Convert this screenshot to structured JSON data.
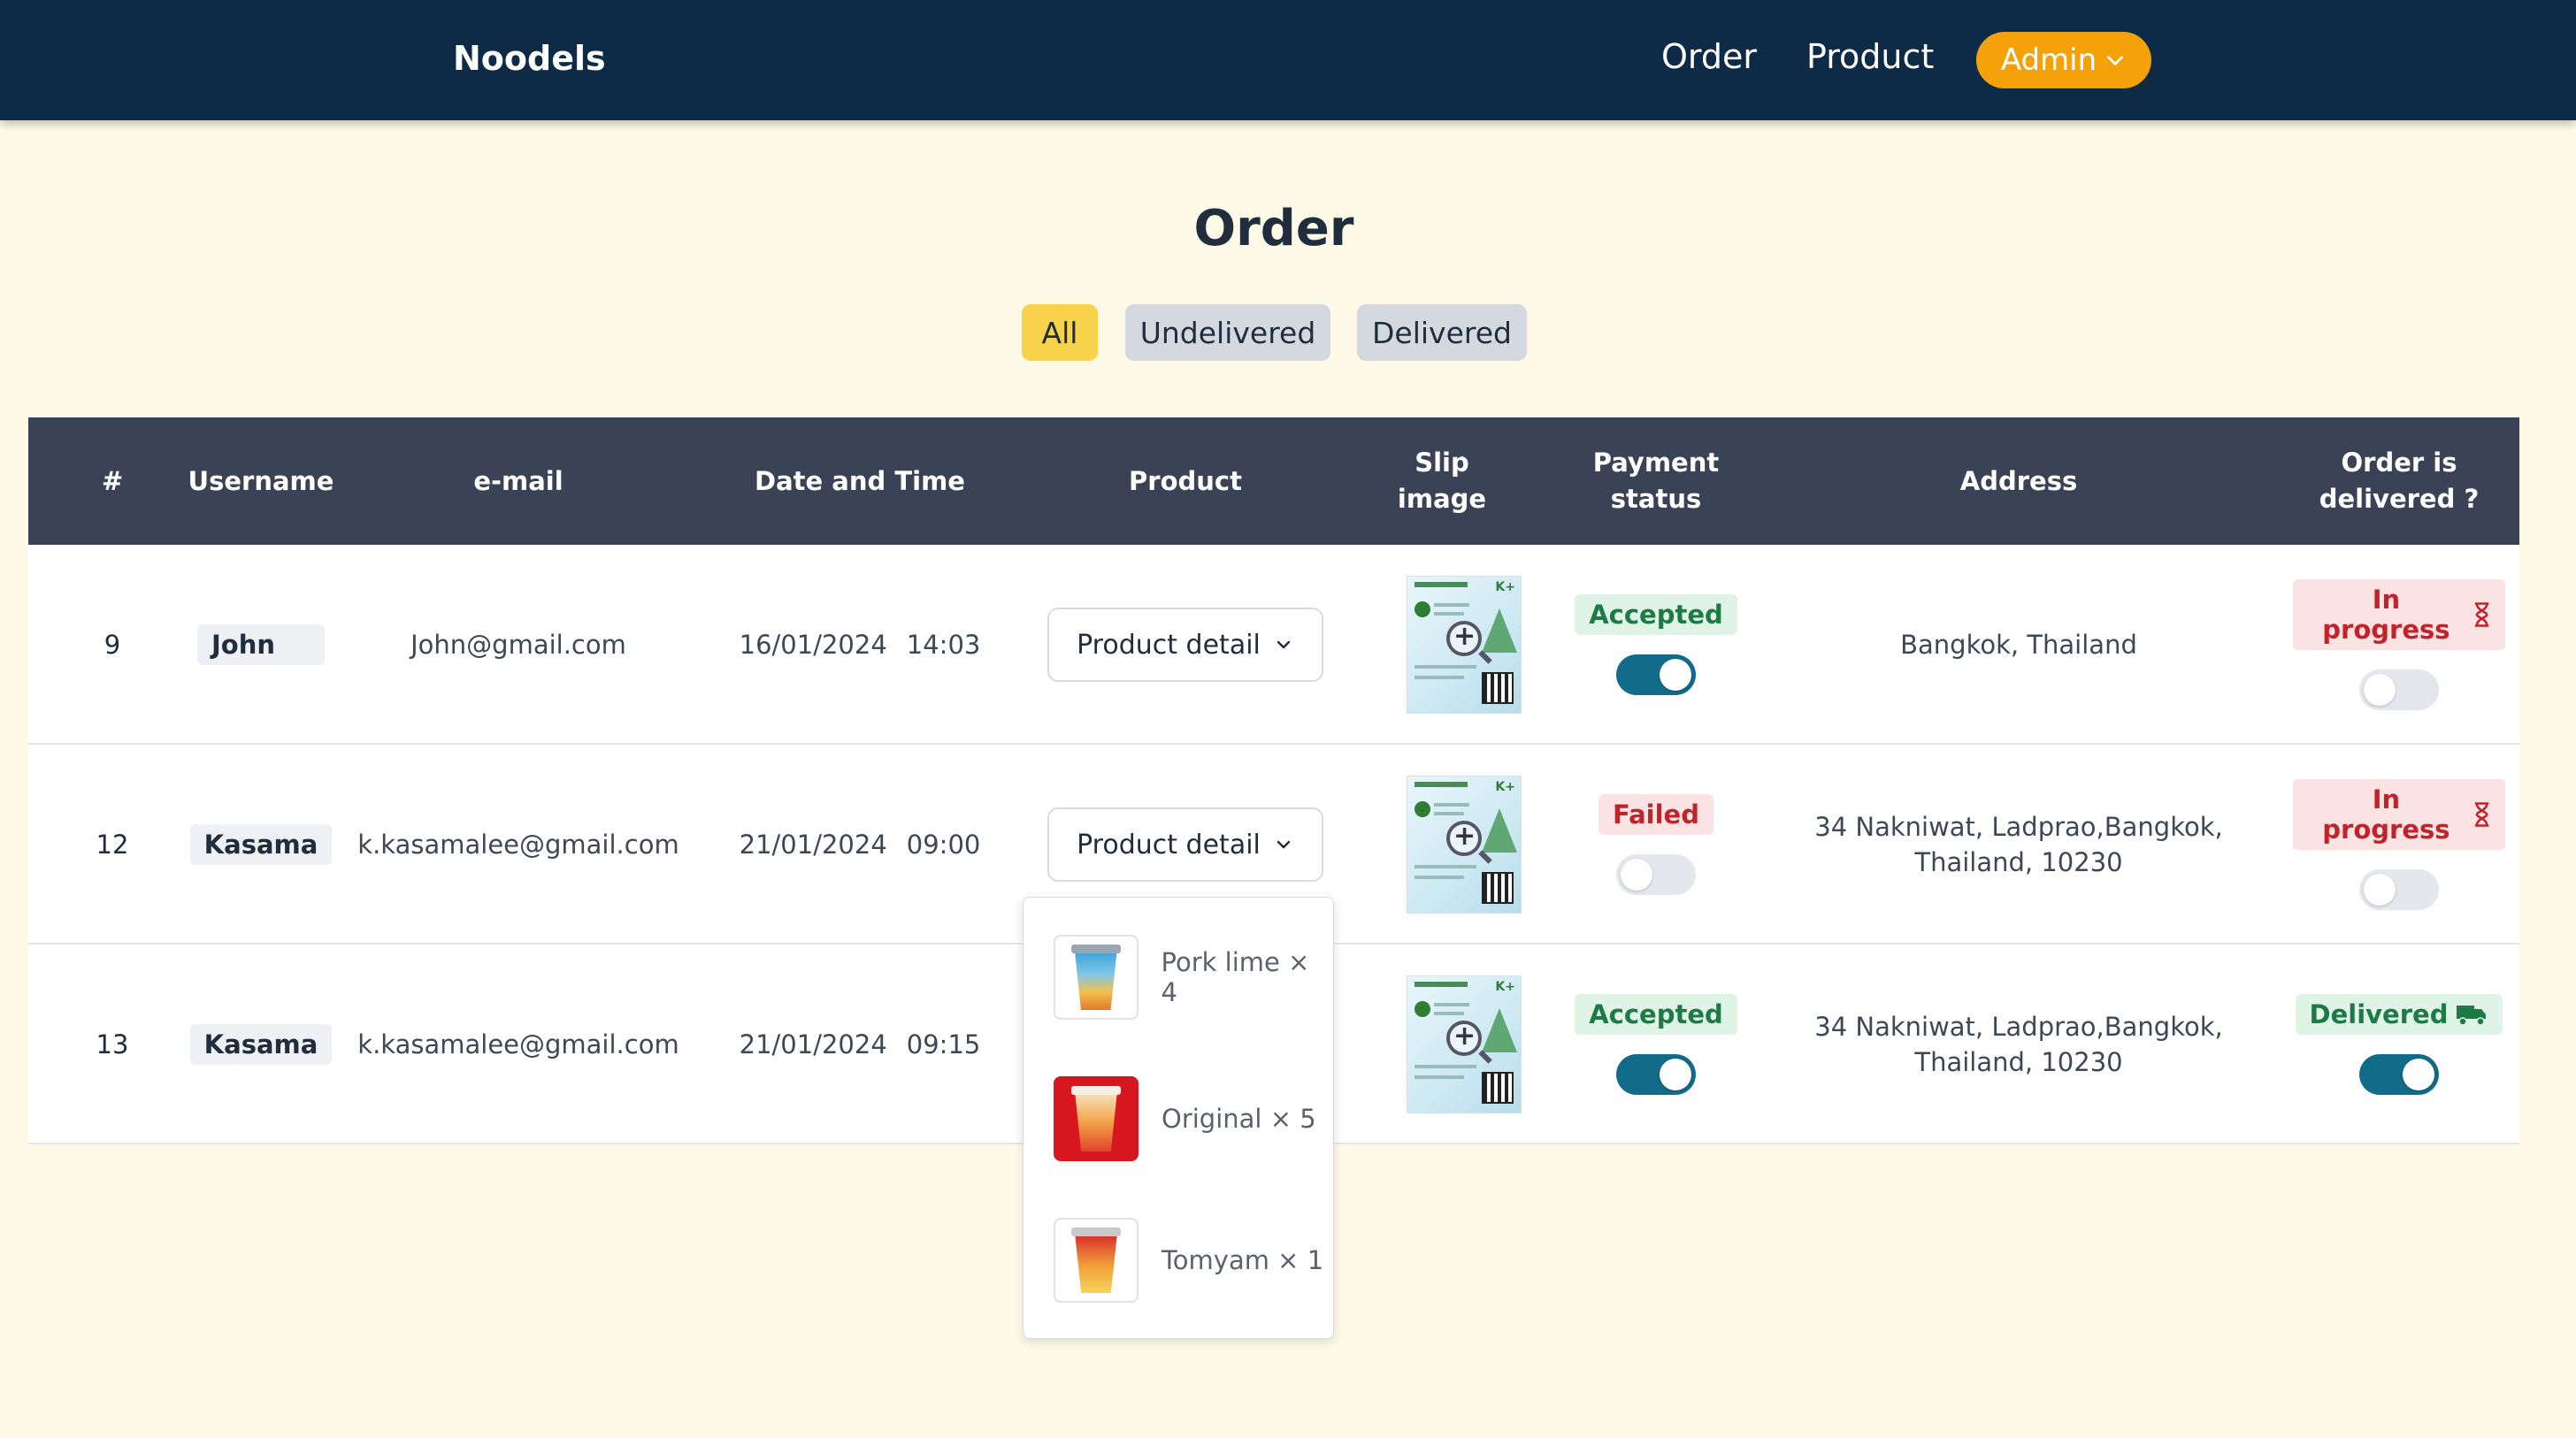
{
  "nav": {
    "brand": "Noodels",
    "links": [
      "Order",
      "Product"
    ],
    "admin_label": "Admin"
  },
  "page": {
    "title": "Order",
    "filters": [
      "All",
      "Undelivered",
      "Delivered"
    ],
    "active_filter": "All"
  },
  "table": {
    "headers": {
      "num": "#",
      "username": "Username",
      "email": "e-mail",
      "datetime": "Date and Time",
      "product": "Product",
      "slip_1": "Slip",
      "slip_2": "image",
      "payment_1": "Payment",
      "payment_2": "status",
      "address": "Address",
      "delivered_1": "Order is",
      "delivered_2": "delivered ?"
    },
    "rows": [
      {
        "num": "9",
        "username": "John",
        "email": "John@gmail.com",
        "date": "16/01/2024",
        "time": "14:03",
        "product_btn": "Product detail",
        "payment_status": "Accepted",
        "payment_on": true,
        "address_1": "Bangkok, Thailand",
        "address_2": "",
        "delivery_status": "In progress",
        "delivery_icon": "hourglass-icon",
        "delivered_on": false
      },
      {
        "num": "12",
        "username": "Kasama",
        "email": "k.kasamalee@gmail.com",
        "date": "21/01/2024",
        "time": "09:00",
        "product_btn": "Product detail",
        "payment_status": "Failed",
        "payment_on": false,
        "address_1": "34 Nakniwat, Ladprao,Bangkok,",
        "address_2": "Thailand, 10230",
        "delivery_status": "In progress",
        "delivery_icon": "hourglass-icon",
        "delivered_on": false
      },
      {
        "num": "13",
        "username": "Kasama",
        "email": "k.kasamalee@gmail.com",
        "date": "21/01/2024",
        "time": "09:15",
        "product_btn": "",
        "payment_status": "Accepted",
        "payment_on": true,
        "address_1": "34 Nakniwat, Ladprao,Bangkok,",
        "address_2": "Thailand, 10230",
        "delivery_status": "Delivered",
        "delivery_icon": "truck-icon",
        "delivered_on": true
      }
    ]
  },
  "dropdown": {
    "items": [
      {
        "label": "Pork lime × 4",
        "icon": "noodle-cup-pork-lime"
      },
      {
        "label": "Original × 5",
        "icon": "noodle-cup-original"
      },
      {
        "label": "Tomyam × 1",
        "icon": "noodle-cup-tomyam"
      }
    ]
  },
  "colors": {
    "navbar": "#0d2a47",
    "page_bg": "#fefae8",
    "admin_btn": "#f5a10a",
    "active_filter": "#f8d24a",
    "table_header": "#3a4355",
    "toggle_on": "#136b8a",
    "accepted": "#1e7a45",
    "failed": "#c0232a"
  }
}
